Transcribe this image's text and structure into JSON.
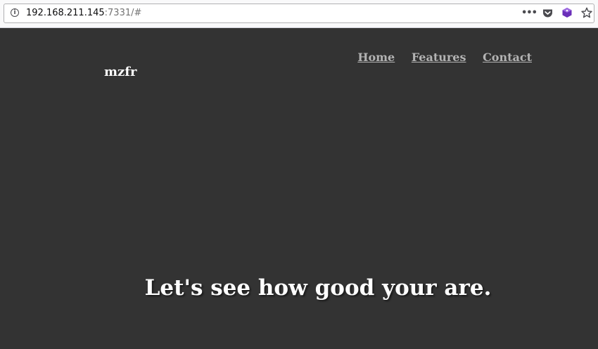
{
  "browser": {
    "url_host": "192.168.211.145",
    "url_rest": ":7331/#",
    "icons": [
      "info-icon",
      "more-actions-icon",
      "pocket-icon",
      "extension-icon",
      "bookmark-star-icon"
    ]
  },
  "site": {
    "brand": "mzfr",
    "nav": [
      {
        "label": "Home"
      },
      {
        "label": "Features"
      },
      {
        "label": "Contact"
      }
    ],
    "headline": "Let's see how good your are."
  },
  "colors": {
    "page_background": "#333333",
    "nav_link": "#b3b3b3",
    "text": "#ffffff"
  }
}
